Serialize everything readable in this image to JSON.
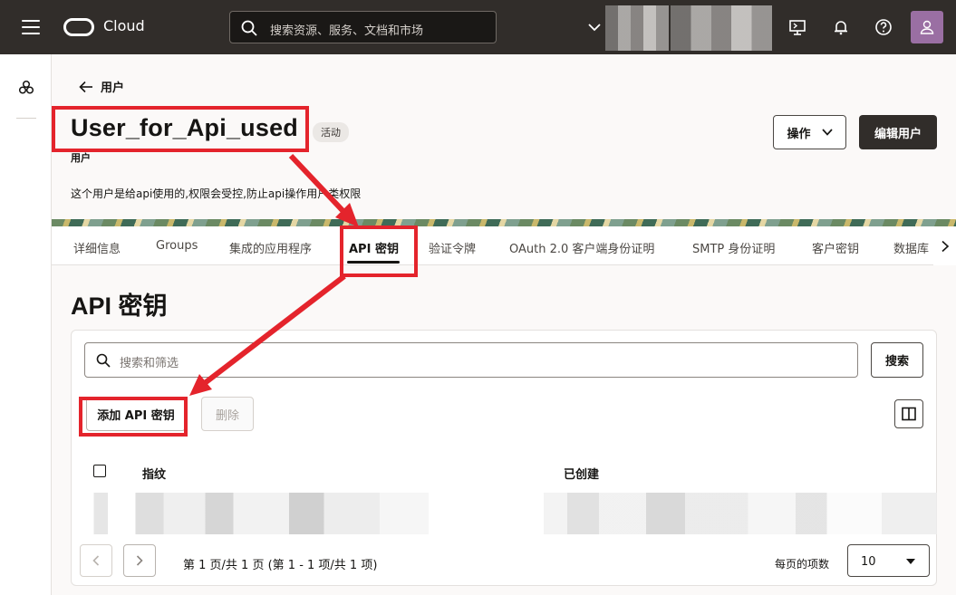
{
  "topbar": {
    "logo_text": "Cloud",
    "search_placeholder": "搜索资源、服务、文档和市场"
  },
  "header": {
    "back_label": "用户",
    "title": "User_for_Api_used",
    "status_badge": "活动",
    "subtitle": "用户",
    "description": "这个用户是给api使用的,权限会受控,防止api操作用户类权限",
    "actions_label": "操作",
    "edit_label": "编辑用户"
  },
  "tabs": [
    {
      "label": "详细信息"
    },
    {
      "label": "Groups"
    },
    {
      "label": "集成的应用程序"
    },
    {
      "label": "API 密钥",
      "active": true
    },
    {
      "label": "验证令牌"
    },
    {
      "label": "OAuth 2.0 客户端身份证明"
    },
    {
      "label": "SMTP 身份证明"
    },
    {
      "label": "客户密钥"
    },
    {
      "label": "数据库"
    }
  ],
  "section": {
    "title": "API 密钥",
    "filter_placeholder": "搜索和筛选",
    "search_button": "搜索",
    "add_button": "添加 API 密钥",
    "delete_button": "删除",
    "columns": [
      "指纹",
      "已创建"
    ],
    "pagination_info": "第 1 页/共 1 页 (第 1 - 1 项/共 1 项)",
    "per_page_label": "每页的项数",
    "per_page_value": "10"
  },
  "colors": {
    "topbar": "#312d2a",
    "annotation_red": "#e4242c",
    "primary_button": "#312d2a"
  }
}
